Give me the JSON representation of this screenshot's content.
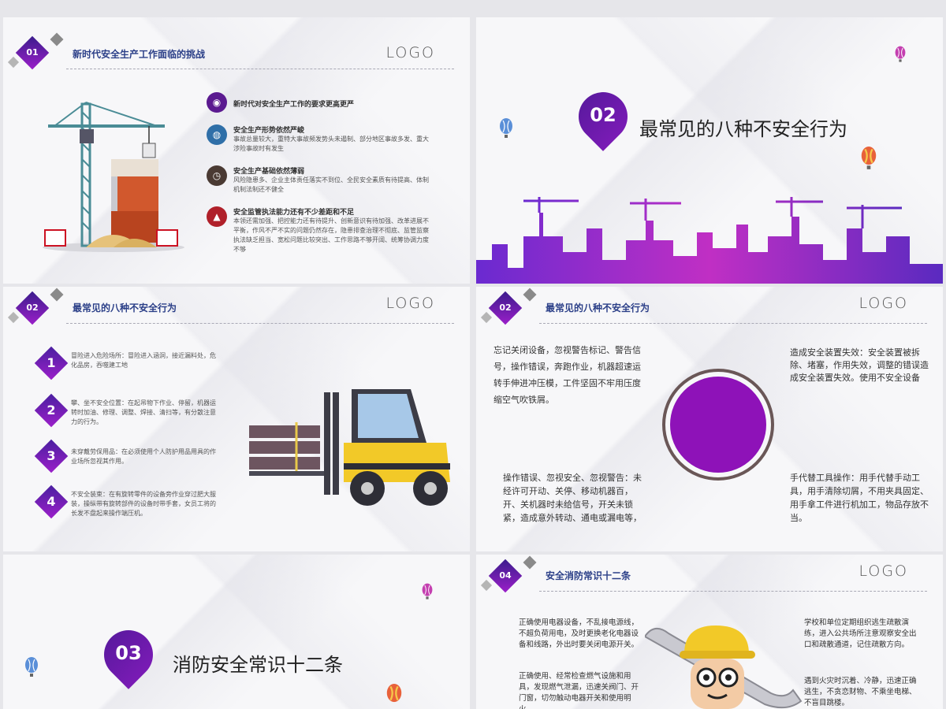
{
  "logo": "LOGO",
  "slide1": {
    "badge": "01",
    "title": "新时代安全生产工作面临的挑战",
    "items": [
      {
        "heading": "新时代对安全生产工作的要求更高更严",
        "body": "",
        "icon": "eye-icon",
        "color": "#5b1a90"
      },
      {
        "heading": "安全生产形势依然严峻",
        "body": "事故总量较大，重特大事故频发势头未遏制、部分地区事故多发、重大涉险事故时有发生",
        "icon": "globe-icon",
        "color": "#2f6fa8"
      },
      {
        "heading": "安全生产基础依然薄弱",
        "body": "风险隐患多、企业主体责任落实不到位、全民安全素质有待提高、体制机制法制还不健全",
        "icon": "clock-icon",
        "color": "#4a3a33"
      },
      {
        "heading": "安全监管执法能力还有不少差距和不足",
        "body": "本领还需加强、把控能力还有待提升、创新意识有待加强、改革进展不平衡，作风不严不实的问题仍然存在，隐患排查治理不彻底、监管监察执法缺乏担当、宽松问题比较突出、工作思路不够开阔、统筹协调力度不够",
        "icon": "flame-icon",
        "color": "#b0202a"
      }
    ]
  },
  "slide2": {
    "badge": "02",
    "title": "最常见的八种不安全行为"
  },
  "slide3": {
    "badge": "02",
    "title": "最常见的八种不安全行为",
    "items": [
      {
        "num": "1",
        "text": "冒险进入危险场所：冒险进入涵洞，接近漏料处，危化品房，吞噬建工地"
      },
      {
        "num": "2",
        "text": "攀、坐不安全位置：在起吊物下作业、停留，机器运转时加油、修理、调整、焊接、清扫等，有分散注意力的行为。"
      },
      {
        "num": "3",
        "text": "未穿戴劳保用品：在必须使用个人防护用品用具的作业场所忽视其作用。"
      },
      {
        "num": "4",
        "text": "不安全装束：在有旋转零件的设备旁作业穿过肥大服装，操纵带有旋转部件的设备时带手套，女员工将的长发不盘起来操作端压机。"
      }
    ]
  },
  "slide4": {
    "badge": "02",
    "title": "最常见的八种不安全行为",
    "tl": "忘记关闭设备，忽视警告标记、警告信号，操作错误，奔跑作业，机器超速运转手伸进冲压模，工件坚固不牢用压度缩空气吹铁屑。",
    "tr": "造成安全装置失效：安全装置被拆除、堵塞，作用失效，调整的错误造成安全装置失效。使用不安全设备",
    "bl": "操作错误、忽视安全、忽视警告：未经许可开动、关停、移动机器百，开、关机器时未给信号，开关未锁紧，造成意外转动、通电或漏电等，",
    "br": "手代替工具操作：用手代替手动工具，用手清除切屑，不用夹具固定、用手拿工件进行机加工，物品存放不当。"
  },
  "slide5": {
    "badge": "03",
    "title": "消防安全常识十二条"
  },
  "slide6": {
    "badge": "04",
    "title": "安全消防常识十二条",
    "l1": "正确使用电器设备，不乱接电源线，不超负荷用电，及时更换老化电器设备和线路，外出时要关闭电源开关。",
    "l2": "正确使用、经常检查燃气设施和用具，发现燃气泄漏，迅速关阀门、开门窗，切勿触动电器开关和使用明火。",
    "r1": "学校和单位定期组织逃生疏散演练，进入公共场所注意观察安全出口和疏散通道，记住疏散方向。",
    "r2": "遇到火灾时沉着、冷静，迅速正确逃生，不贪恋财物、不乘坐电梯、不盲目跳楼。"
  }
}
